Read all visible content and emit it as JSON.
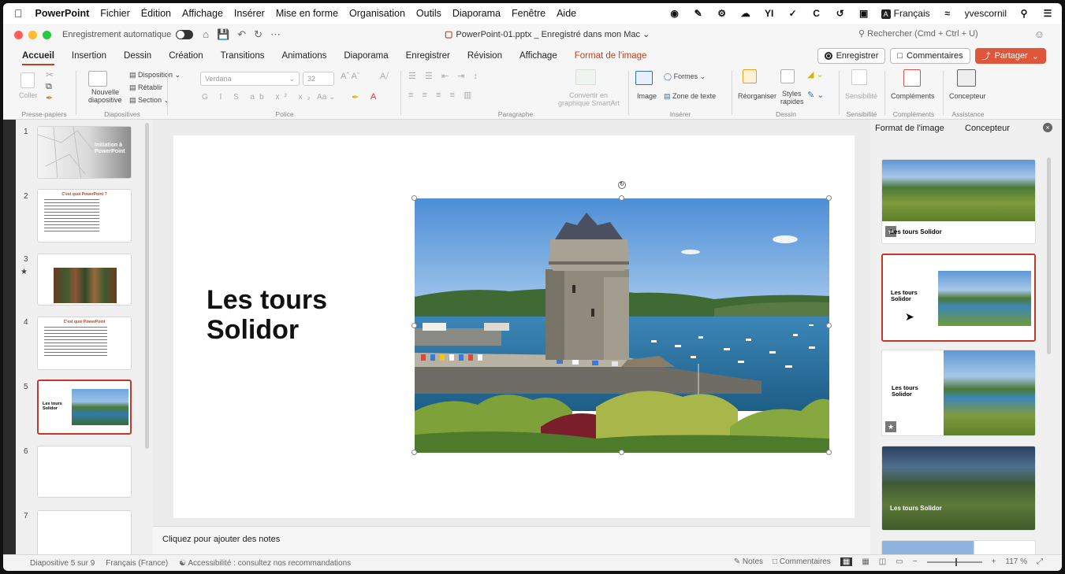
{
  "menubar": {
    "app": "PowerPoint",
    "items": [
      "Fichier",
      "Édition",
      "Affichage",
      "Insérer",
      "Mise en forme",
      "Organisation",
      "Outils",
      "Diaporama",
      "Fenêtre",
      "Aide"
    ],
    "input_source": "Français",
    "input_badge": "A",
    "user": "yvescornil"
  },
  "titlebar": {
    "autosave_label": "Enregistrement automatique",
    "doc_title": "PowerPoint-01.pptx _ Enregistré dans mon Mac",
    "search_placeholder": "Rechercher (Cmd + Ctrl + U)"
  },
  "tabs": {
    "items": [
      "Accueil",
      "Insertion",
      "Dessin",
      "Création",
      "Transitions",
      "Animations",
      "Diaporama",
      "Enregistrer",
      "Révision",
      "Affichage",
      "Format de l'image"
    ],
    "record_label": "Enregistrer",
    "comments_label": "Commentaires",
    "share_label": "Partager"
  },
  "ribbon": {
    "paste": "Coller",
    "new_slide_1": "Nouvelle",
    "new_slide_2": "diapositive",
    "layout": "Disposition",
    "reset": "Rétablir",
    "section": "Section",
    "font_name": "Verdana",
    "font_size": "32",
    "smartart_1": "Convertir en",
    "smartart_2": "graphique SmartArt",
    "image": "Image",
    "shapes": "Formes",
    "textbox": "Zone de texte",
    "arrange": "Réorganiser",
    "quick_styles_1": "Styles",
    "quick_styles_2": "rapides",
    "sensitivity": "Sensibilité",
    "addins": "Compléments",
    "designer": "Concepteur",
    "groups": {
      "clipboard": "Presse-papiers",
      "slides": "Diapositives",
      "font": "Police",
      "paragraph": "Paragraphe",
      "insert": "Insérer",
      "drawing": "Dessin",
      "sensitivity": "Sensibilité",
      "addins": "Compléments",
      "assistance": "Assistance"
    }
  },
  "thumbnails": [
    {
      "num": "1",
      "title_1": "Initiation à",
      "title_2": "PowerPoint"
    },
    {
      "num": "2",
      "heading": "C'est quoi PowerPoint ?"
    },
    {
      "num": "3"
    },
    {
      "num": "4",
      "heading": "C'est quoi PowerPoint"
    },
    {
      "num": "5",
      "title_1": "Les tours",
      "title_2": "Solidor"
    },
    {
      "num": "6"
    },
    {
      "num": "7"
    }
  ],
  "slide": {
    "title_1": "Les tours",
    "title_2": "Solidor"
  },
  "notes_placeholder": "Cliquez pour ajouter des notes",
  "designer_pane": {
    "tab_format": "Format de l'image",
    "tab_designer": "Concepteur",
    "card_title_full": "Les tours Solidor",
    "card_title_1": "Les tours",
    "card_title_2": "Solidor"
  },
  "status": {
    "slide_counter": "Diapositive 5 sur 9",
    "language": "Français (France)",
    "accessibility": "Accessibilité : consultez nos recommandations",
    "notes": "Notes",
    "comments": "Commentaires",
    "zoom": "117 %"
  },
  "colors": {
    "accent": "#c43e1c",
    "selection": "#c0392b",
    "share": "#e0563b"
  }
}
